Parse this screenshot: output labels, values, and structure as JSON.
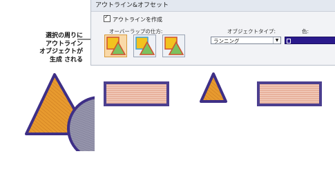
{
  "callout": {
    "lines": [
      "選択の周りに",
      "アウトライン",
      "オブジェクトが",
      "生成 される"
    ]
  },
  "dialog": {
    "title": "アウトライン&オフセット",
    "create_outline_label": "アウトラインを作成",
    "create_outline_checked": true,
    "overlap_label": "オーバーラップの仕方:",
    "object_type_label": "オブジェクトタイプ:",
    "object_type_value": "ランニング",
    "color_label": "色:",
    "color_value": "#2a1a8c"
  },
  "colors": {
    "fill_orange": "#e79a2f",
    "outline_purple": "#3e2f86",
    "circle_gray": "#8f8ea6"
  }
}
